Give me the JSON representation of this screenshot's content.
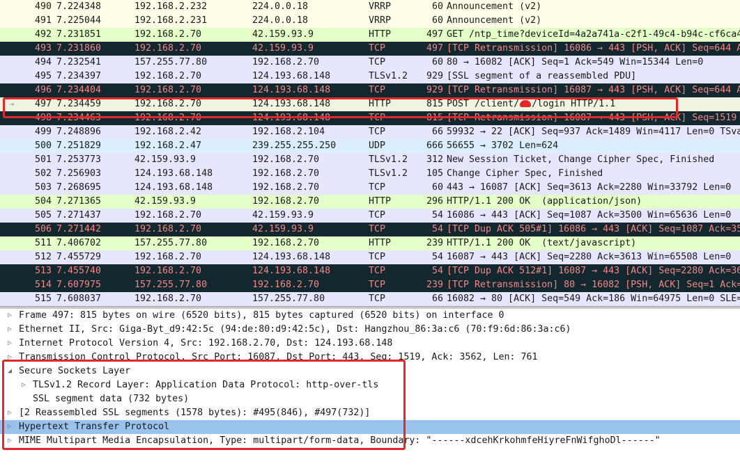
{
  "packets": [
    {
      "no": "490",
      "time": "7.224348",
      "src": "192.168.2.232",
      "dst": "224.0.0.18",
      "proto": "VRRP",
      "len": "60",
      "info": "Announcement (v2)",
      "style": "yellow"
    },
    {
      "no": "491",
      "time": "7.225044",
      "src": "192.168.2.231",
      "dst": "224.0.0.18",
      "proto": "VRRP",
      "len": "60",
      "info": "Announcement (v2)",
      "style": "yellow"
    },
    {
      "no": "492",
      "time": "7.231851",
      "src": "192.168.2.70",
      "dst": "42.159.93.9",
      "proto": "HTTP",
      "len": "497",
      "info": "GET /ntp_time?deviceId=4a2a741a-c2f1-49c4-b94c-cf6ca4",
      "style": "http"
    },
    {
      "no": "493",
      "time": "7.231860",
      "src": "192.168.2.70",
      "dst": "42.159.93.9",
      "proto": "TCP",
      "len": "497",
      "info": "[TCP Retransmission] 16086 → 443 [PSH, ACK] Seq=644 A",
      "style": "bad"
    },
    {
      "no": "494",
      "time": "7.232541",
      "src": "157.255.77.80",
      "dst": "192.168.2.70",
      "proto": "TCP",
      "len": "60",
      "info": "80 → 16082 [ACK] Seq=1 Ack=549 Win=15344 Len=0",
      "style": "tcp"
    },
    {
      "no": "495",
      "time": "7.234397",
      "src": "192.168.2.70",
      "dst": "124.193.68.148",
      "proto": "TLSv1.2",
      "len": "929",
      "info": "[SSL segment of a reassembled PDU]",
      "style": "tcp"
    },
    {
      "no": "496",
      "time": "7.234404",
      "src": "192.168.2.70",
      "dst": "124.193.68.148",
      "proto": "TCP",
      "len": "929",
      "info": "[TCP Retransmission] 16087 → 443 [PSH, ACK] Seq=644 A",
      "style": "bad"
    },
    {
      "no": "497",
      "time": "7.234459",
      "src": "192.168.2.70",
      "dst": "124.193.68.148",
      "proto": "HTTP",
      "len": "815",
      "info": "POST /client/",
      "info_after": "/login HTTP/1.1",
      "style": "sel",
      "redacted": true
    },
    {
      "no": "498",
      "time": "7.234463",
      "src": "192.168.2.70",
      "dst": "124.193.68.148",
      "proto": "TCP",
      "len": "815",
      "info": "[TCP Retransmission] 16087 → 443 [PSH, ACK] Seq=1519",
      "style": "bad"
    },
    {
      "no": "499",
      "time": "7.248896",
      "src": "192.168.2.42",
      "dst": "192.168.2.104",
      "proto": "TCP",
      "len": "66",
      "info": "59932 → 22 [ACK] Seq=937 Ack=1489 Win=4117 Len=0 TSva",
      "style": "tcp"
    },
    {
      "no": "500",
      "time": "7.251829",
      "src": "192.168.2.47",
      "dst": "239.255.255.250",
      "proto": "UDP",
      "len": "666",
      "info": "56655 → 3702 Len=624",
      "style": "udp"
    },
    {
      "no": "501",
      "time": "7.253773",
      "src": "42.159.93.9",
      "dst": "192.168.2.70",
      "proto": "TLSv1.2",
      "len": "312",
      "info": "New Session Ticket, Change Cipher Spec, Finished",
      "style": "tcp"
    },
    {
      "no": "502",
      "time": "7.256903",
      "src": "124.193.68.148",
      "dst": "192.168.2.70",
      "proto": "TLSv1.2",
      "len": "105",
      "info": "Change Cipher Spec, Finished",
      "style": "tcp"
    },
    {
      "no": "503",
      "time": "7.268695",
      "src": "124.193.68.148",
      "dst": "192.168.2.70",
      "proto": "TCP",
      "len": "60",
      "info": "443 → 16087 [ACK] Seq=3613 Ack=2280 Win=33792 Len=0",
      "style": "tcp"
    },
    {
      "no": "504",
      "time": "7.271365",
      "src": "42.159.93.9",
      "dst": "192.168.2.70",
      "proto": "HTTP",
      "len": "296",
      "info": "HTTP/1.1 200 OK  (application/json)",
      "style": "http"
    },
    {
      "no": "505",
      "time": "7.271437",
      "src": "192.168.2.70",
      "dst": "42.159.93.9",
      "proto": "TCP",
      "len": "54",
      "info": "16086 → 443 [ACK] Seq=1087 Ack=3500 Win=65636 Len=0",
      "style": "tcp"
    },
    {
      "no": "506",
      "time": "7.271442",
      "src": "192.168.2.70",
      "dst": "42.159.93.9",
      "proto": "TCP",
      "len": "54",
      "info": "[TCP Dup ACK 505#1] 16086 → 443 [ACK] Seq=1087 Ack=35",
      "style": "bad"
    },
    {
      "no": "511",
      "time": "7.406702",
      "src": "157.255.77.80",
      "dst": "192.168.2.70",
      "proto": "HTTP",
      "len": "239",
      "info": "HTTP/1.1 200 OK  (text/javascript)",
      "style": "http"
    },
    {
      "no": "512",
      "time": "7.455729",
      "src": "192.168.2.70",
      "dst": "124.193.68.148",
      "proto": "TCP",
      "len": "54",
      "info": "16087 → 443 [ACK] Seq=2280 Ack=3613 Win=65508 Len=0",
      "style": "tcp"
    },
    {
      "no": "513",
      "time": "7.455740",
      "src": "192.168.2.70",
      "dst": "124.193.68.148",
      "proto": "TCP",
      "len": "54",
      "info": "[TCP Dup ACK 512#1] 16087 → 443 [ACK] Seq=2280 Ack=36",
      "style": "bad"
    },
    {
      "no": "514",
      "time": "7.607975",
      "src": "157.255.77.80",
      "dst": "192.168.2.70",
      "proto": "TCP",
      "len": "239",
      "info": "[TCP Retransmission] 80 → 16082 [PSH, ACK] Seq=1 Ack=",
      "style": "bad"
    },
    {
      "no": "515",
      "time": "7.608037",
      "src": "192.168.2.70",
      "dst": "157.255.77.80",
      "proto": "TCP",
      "len": "66",
      "info": "16082 → 80 [ACK] Seq=549 Ack=186 Win=64975 Len=0 SLE=",
      "style": "tcp"
    }
  ],
  "details": [
    {
      "arrow": "collapsed",
      "indent": 0,
      "text": "Frame 497: 815 bytes on wire (6520 bits), 815 bytes captured (6520 bits) on interface 0"
    },
    {
      "arrow": "collapsed",
      "indent": 0,
      "text": "Ethernet II, Src: Giga-Byt_d9:42:5c (94:de:80:d9:42:5c), Dst: Hangzhou_86:3a:c6 (70:f9:6d:86:3a:c6)"
    },
    {
      "arrow": "collapsed",
      "indent": 0,
      "text": "Internet Protocol Version 4, Src: 192.168.2.70, Dst: 124.193.68.148"
    },
    {
      "arrow": "collapsed",
      "indent": 0,
      "text": "Transmission Control Protocol, Src Port: 16087, Dst Port: 443, Seq: 1519, Ack: 3562, Len: 761"
    },
    {
      "arrow": "expanded",
      "indent": 0,
      "text": "Secure Sockets Layer"
    },
    {
      "arrow": "collapsed",
      "indent": 1,
      "text": "TLSv1.2 Record Layer: Application Data Protocol: http-over-tls"
    },
    {
      "arrow": "none",
      "indent": 1,
      "text": "SSL segment data (732 bytes)"
    },
    {
      "arrow": "collapsed",
      "indent": 0,
      "text": "[2 Reassembled SSL segments (1578 bytes): #495(846), #497(732)]"
    },
    {
      "arrow": "collapsed",
      "indent": 0,
      "text": "Hypertext Transfer Protocol",
      "highlight": true
    },
    {
      "arrow": "collapsed",
      "indent": 0,
      "text": "MIME Multipart Media Encapsulation, Type: multipart/form-data, Boundary: \"------xdcehKrkohmfeHiyreFnWifghoDl------\""
    }
  ]
}
